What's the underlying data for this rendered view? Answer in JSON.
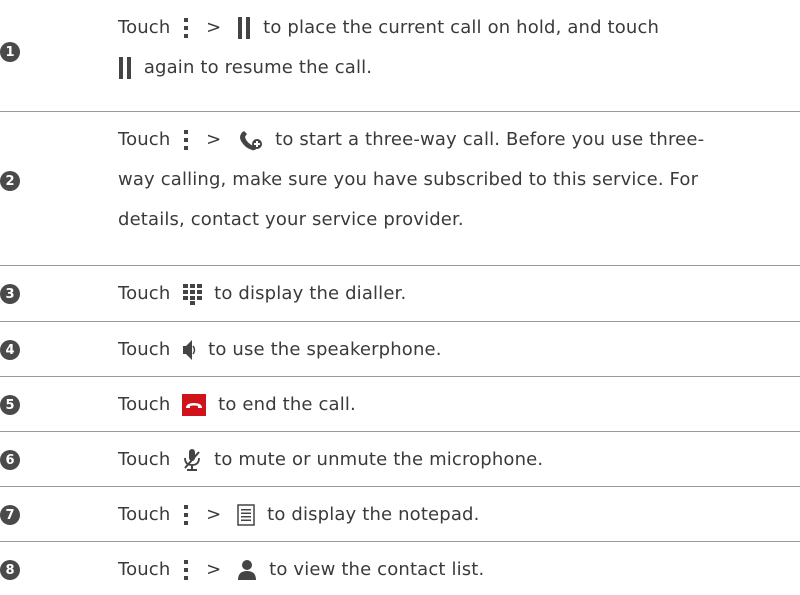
{
  "rows": [
    {
      "num": "1",
      "lines": [
        "Touch",
        ">",
        "to place the current call on hold, and touch",
        "again to resume the call."
      ]
    },
    {
      "num": "2",
      "lines": [
        "Touch",
        ">",
        "to start a three-way call. Before you use three-",
        "way calling, make sure you have subscribed to this service. For",
        "details, contact your service provider."
      ]
    },
    {
      "num": "3",
      "lines": [
        "Touch",
        "to display the dialler."
      ]
    },
    {
      "num": "4",
      "lines": [
        "Touch",
        "to use the speakerphone."
      ]
    },
    {
      "num": "5",
      "lines": [
        "Touch",
        "to end the call."
      ]
    },
    {
      "num": "6",
      "lines": [
        "Touch",
        "to mute or unmute the microphone."
      ]
    },
    {
      "num": "7",
      "lines": [
        "Touch",
        ">",
        "to display the notepad."
      ]
    },
    {
      "num": "8",
      "lines": [
        "Touch",
        ">",
        "to view the contact list."
      ]
    }
  ],
  "icons": {
    "menu": "more-vertical-icon",
    "hold": "pause-hold-icon",
    "add_call": "add-call-icon",
    "dialpad": "dialpad-icon",
    "speaker": "speaker-icon",
    "end_call": "end-call-icon",
    "mute": "mic-mute-icon",
    "notepad": "notepad-icon",
    "contacts": "contact-icon"
  },
  "colors": {
    "end_call": "#d0121b",
    "icon": "#444444",
    "number_badge": "#4a4a4a"
  }
}
